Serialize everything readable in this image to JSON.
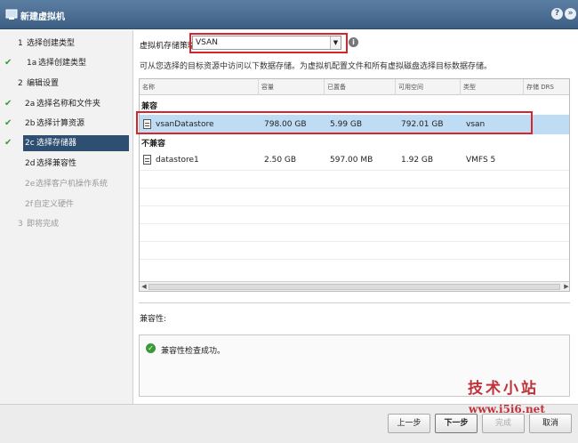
{
  "window": {
    "title": "新建虚拟机",
    "help": "?",
    "expand": "»"
  },
  "nav": [
    {
      "num": "1",
      "label": "选择创建类型",
      "check": "",
      "state": "normal"
    },
    {
      "num": "1a",
      "label": "选择创建类型",
      "check": "✔",
      "state": "normal"
    },
    {
      "num": "2",
      "label": "编辑设置",
      "check": "",
      "state": "normal"
    },
    {
      "num": "2a",
      "label": "选择名称和文件夹",
      "check": "✔",
      "state": "normal"
    },
    {
      "num": "2b",
      "label": "选择计算资源",
      "check": "✔",
      "state": "normal"
    },
    {
      "num": "2c",
      "label": "选择存储器",
      "check": "✔",
      "state": "active"
    },
    {
      "num": "2d",
      "label": "选择兼容性",
      "check": "",
      "state": "normal"
    },
    {
      "num": "2e",
      "label": "选择客户机操作系统",
      "check": "",
      "state": "disabled"
    },
    {
      "num": "2f",
      "label": "自定义硬件",
      "check": "",
      "state": "disabled"
    },
    {
      "num": "3",
      "label": "即将完成",
      "check": "",
      "state": "disabled"
    }
  ],
  "policy": {
    "label": "虚拟机存储策略:",
    "value": "VSAN",
    "arrow": "▼",
    "info": "i"
  },
  "description": "可从您选择的目标资源中访问以下数据存储。为虚拟机配置文件和所有虚拟磁盘选择目标数据存储。",
  "table": {
    "columns": [
      "名称",
      "容量",
      "已置备",
      "可用空间",
      "类型",
      "存储 DRS"
    ],
    "groups": [
      {
        "label": "兼容",
        "rows": [
          {
            "name": "vsanDatastore",
            "capacity": "798.00 GB",
            "provisioned": "5.99 GB",
            "free": "792.01 GB",
            "type": "vsan",
            "drs": ""
          }
        ]
      },
      {
        "label": "不兼容",
        "rows": [
          {
            "name": "datastore1",
            "capacity": "2.50 GB",
            "provisioned": "597.00 MB",
            "free": "1.92 GB",
            "type": "VMFS 5",
            "drs": ""
          }
        ]
      }
    ]
  },
  "compatibility": {
    "label": "兼容性:",
    "icon": "✓",
    "message": "兼容性检查成功。"
  },
  "watermark": {
    "title": "技术小站",
    "url": "www.i5i6.net"
  },
  "buttons": {
    "back": "上一步",
    "next": "下一步",
    "finish": "完成",
    "cancel": "取消"
  },
  "colors": {
    "accent": "#2f4f72",
    "highlight": "#d9242a",
    "selected_row": "#bfdcf5",
    "success": "#3a9a3a"
  }
}
